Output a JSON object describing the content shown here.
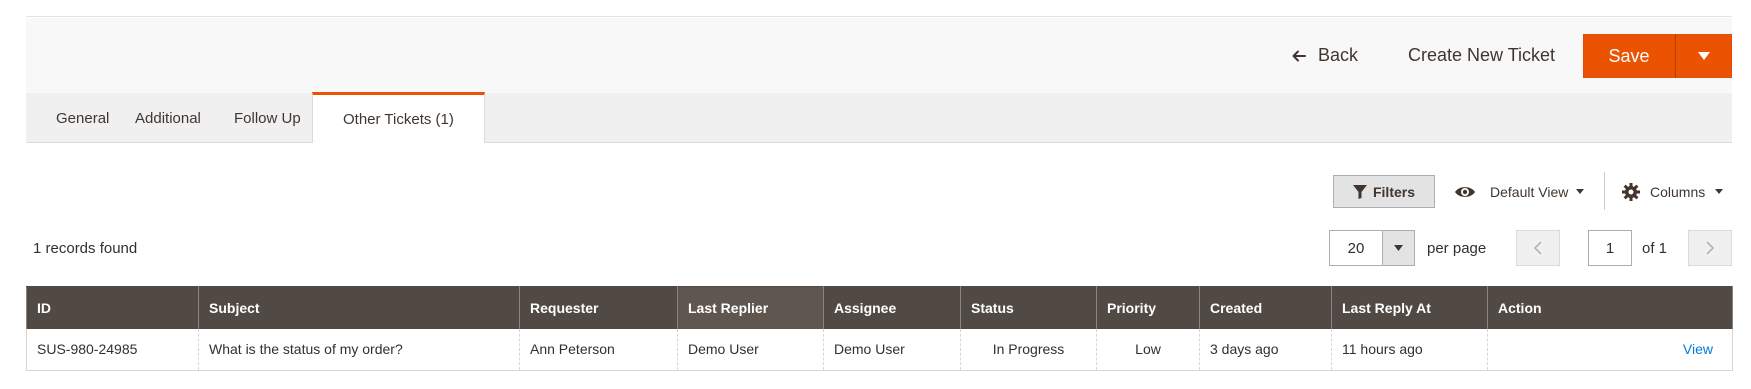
{
  "page_actions": {
    "back_label": "Back",
    "create_label": "Create New Ticket",
    "save_label": "Save"
  },
  "tabs": [
    {
      "label": "General"
    },
    {
      "label": "Additional"
    },
    {
      "label": "Follow Up"
    },
    {
      "label": "Other Tickets (1)"
    }
  ],
  "toolbar": {
    "filters_label": "Filters",
    "view_label": "Default View",
    "columns_label": "Columns",
    "records_found": "1 records found",
    "per_page_value": "20",
    "per_page_label": "per page",
    "current_page": "1",
    "total_pages_label": "of 1"
  },
  "grid": {
    "headers": [
      "ID",
      "Subject",
      "Requester",
      "Last Replier",
      "Assignee",
      "Status",
      "Priority",
      "Created",
      "Last Reply At",
      "Action"
    ],
    "rows": [
      {
        "id": "SUS-980-24985",
        "subject": "What is the status of my order?",
        "requester": "Ann Peterson",
        "last_replier": "Demo User",
        "assignee": "Demo User",
        "status": "In Progress",
        "priority": "Low",
        "created": "3 days ago",
        "last_reply_at": "11 hours ago",
        "action": "View"
      }
    ]
  },
  "colors": {
    "accent": "#eb5202",
    "header_bg": "#514943",
    "link": "#007bdb"
  }
}
